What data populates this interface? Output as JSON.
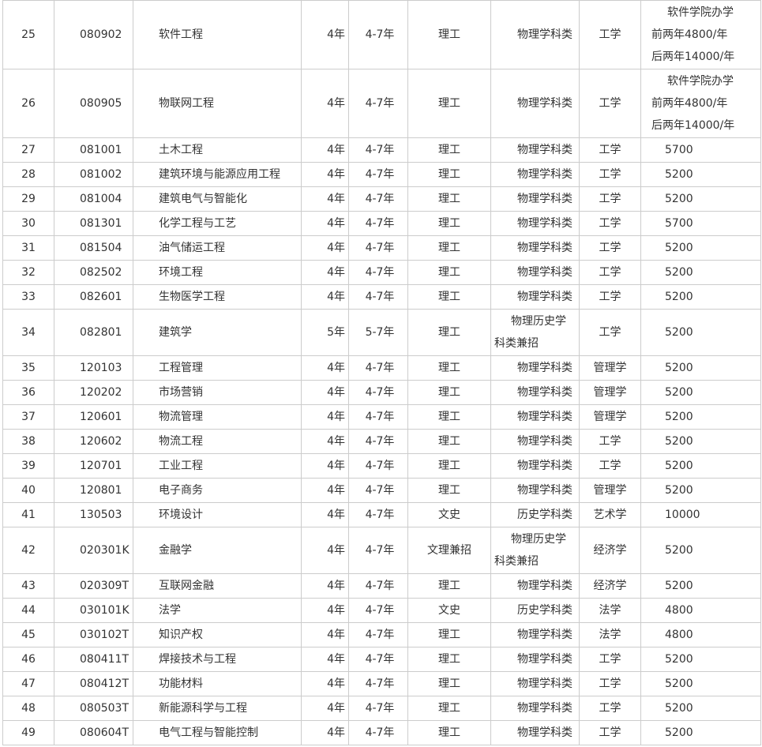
{
  "rows": [
    {
      "seq": "25",
      "code": "080902",
      "name": "软件工程",
      "years": "4年",
      "span": "4-7年",
      "category": "理工",
      "subject": [
        "物理学科类"
      ],
      "degree": "工学",
      "fee": [
        "软件学院办学",
        "前两年4800/年",
        "后两年14000/年"
      ]
    },
    {
      "seq": "26",
      "code": "080905",
      "name": "物联网工程",
      "years": "4年",
      "span": "4-7年",
      "category": "理工",
      "subject": [
        "物理学科类"
      ],
      "degree": "工学",
      "fee": [
        "软件学院办学",
        "前两年4800/年",
        "后两年14000/年"
      ]
    },
    {
      "seq": "27",
      "code": "081001",
      "name": "土木工程",
      "years": "4年",
      "span": "4-7年",
      "category": "理工",
      "subject": [
        "物理学科类"
      ],
      "degree": "工学",
      "fee": [
        "5700"
      ]
    },
    {
      "seq": "28",
      "code": "081002",
      "name": "建筑环境与能源应用工程",
      "years": "4年",
      "span": "4-7年",
      "category": "理工",
      "subject": [
        "物理学科类"
      ],
      "degree": "工学",
      "fee": [
        "5200"
      ]
    },
    {
      "seq": "29",
      "code": "081004",
      "name": "建筑电气与智能化",
      "years": "4年",
      "span": "4-7年",
      "category": "理工",
      "subject": [
        "物理学科类"
      ],
      "degree": "工学",
      "fee": [
        "5200"
      ]
    },
    {
      "seq": "30",
      "code": "081301",
      "name": "化学工程与工艺",
      "years": "4年",
      "span": "4-7年",
      "category": "理工",
      "subject": [
        "物理学科类"
      ],
      "degree": "工学",
      "fee": [
        "5700"
      ]
    },
    {
      "seq": "31",
      "code": "081504",
      "name": "油气储运工程",
      "years": "4年",
      "span": "4-7年",
      "category": "理工",
      "subject": [
        "物理学科类"
      ],
      "degree": "工学",
      "fee": [
        "5200"
      ]
    },
    {
      "seq": "32",
      "code": "082502",
      "name": "环境工程",
      "years": "4年",
      "span": "4-7年",
      "category": "理工",
      "subject": [
        "物理学科类"
      ],
      "degree": "工学",
      "fee": [
        "5200"
      ]
    },
    {
      "seq": "33",
      "code": "082601",
      "name": "生物医学工程",
      "years": "4年",
      "span": "4-7年",
      "category": "理工",
      "subject": [
        "物理学科类"
      ],
      "degree": "工学",
      "fee": [
        "5200"
      ]
    },
    {
      "seq": "34",
      "code": "082801",
      "name": "建筑学",
      "years": "5年",
      "span": "5-7年",
      "category": "理工",
      "subject": [
        "物理历史学",
        "科类兼招"
      ],
      "degree": "工学",
      "fee": [
        "5200"
      ]
    },
    {
      "seq": "35",
      "code": "120103",
      "name": "工程管理",
      "years": "4年",
      "span": "4-7年",
      "category": "理工",
      "subject": [
        "物理学科类"
      ],
      "degree": "管理学",
      "fee": [
        "5200"
      ]
    },
    {
      "seq": "36",
      "code": "120202",
      "name": "市场营销",
      "years": "4年",
      "span": "4-7年",
      "category": "理工",
      "subject": [
        "物理学科类"
      ],
      "degree": "管理学",
      "fee": [
        "5200"
      ]
    },
    {
      "seq": "37",
      "code": "120601",
      "name": "物流管理",
      "years": "4年",
      "span": "4-7年",
      "category": "理工",
      "subject": [
        "物理学科类"
      ],
      "degree": "管理学",
      "fee": [
        "5200"
      ]
    },
    {
      "seq": "38",
      "code": "120602",
      "name": "物流工程",
      "years": "4年",
      "span": "4-7年",
      "category": "理工",
      "subject": [
        "物理学科类"
      ],
      "degree": "工学",
      "fee": [
        "5200"
      ]
    },
    {
      "seq": "39",
      "code": "120701",
      "name": "工业工程",
      "years": "4年",
      "span": "4-7年",
      "category": "理工",
      "subject": [
        "物理学科类"
      ],
      "degree": "工学",
      "fee": [
        "5200"
      ]
    },
    {
      "seq": "40",
      "code": "120801",
      "name": "电子商务",
      "years": "4年",
      "span": "4-7年",
      "category": "理工",
      "subject": [
        "物理学科类"
      ],
      "degree": "管理学",
      "fee": [
        "5200"
      ]
    },
    {
      "seq": "41",
      "code": "130503",
      "name": "环境设计",
      "years": "4年",
      "span": "4-7年",
      "category": "文史",
      "subject": [
        "历史学科类"
      ],
      "degree": "艺术学",
      "fee": [
        "10000"
      ]
    },
    {
      "seq": "42",
      "code": "020301K",
      "name": "金融学",
      "years": "4年",
      "span": "4-7年",
      "category": "文理兼招",
      "subject": [
        "物理历史学",
        "科类兼招"
      ],
      "degree": "经济学",
      "fee": [
        "5200"
      ]
    },
    {
      "seq": "43",
      "code": "020309T",
      "name": "互联网金融",
      "years": "4年",
      "span": "4-7年",
      "category": "理工",
      "subject": [
        "物理学科类"
      ],
      "degree": "经济学",
      "fee": [
        "5200"
      ]
    },
    {
      "seq": "44",
      "code": "030101K",
      "name": "法学",
      "years": "4年",
      "span": "4-7年",
      "category": "文史",
      "subject": [
        "历史学科类"
      ],
      "degree": "法学",
      "fee": [
        "4800"
      ]
    },
    {
      "seq": "45",
      "code": "030102T",
      "name": "知识产权",
      "years": "4年",
      "span": "4-7年",
      "category": "理工",
      "subject": [
        "物理学科类"
      ],
      "degree": "法学",
      "fee": [
        "4800"
      ]
    },
    {
      "seq": "46",
      "code": "080411T",
      "name": "焊接技术与工程",
      "years": "4年",
      "span": "4-7年",
      "category": "理工",
      "subject": [
        "物理学科类"
      ],
      "degree": "工学",
      "fee": [
        "5200"
      ]
    },
    {
      "seq": "47",
      "code": "080412T",
      "name": "功能材料",
      "years": "4年",
      "span": "4-7年",
      "category": "理工",
      "subject": [
        "物理学科类"
      ],
      "degree": "工学",
      "fee": [
        "5200"
      ]
    },
    {
      "seq": "48",
      "code": "080503T",
      "name": "新能源科学与工程",
      "years": "4年",
      "span": "4-7年",
      "category": "理工",
      "subject": [
        "物理学科类"
      ],
      "degree": "工学",
      "fee": [
        "5200"
      ]
    },
    {
      "seq": "49",
      "code": "080604T",
      "name": "电气工程与智能控制",
      "years": "4年",
      "span": "4-7年",
      "category": "理工",
      "subject": [
        "物理学科类"
      ],
      "degree": "工学",
      "fee": [
        "5200"
      ]
    }
  ]
}
